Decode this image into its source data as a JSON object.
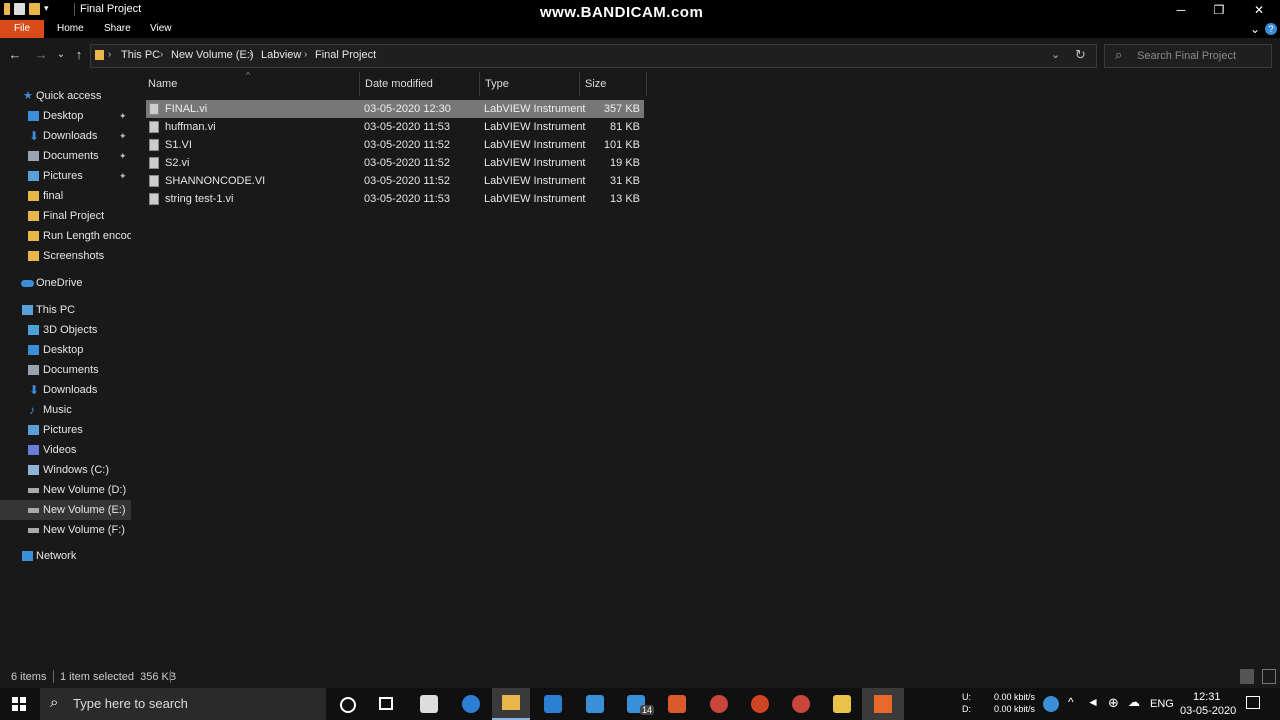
{
  "window": {
    "title": "Final Project",
    "watermark": "www.BANDICAM.com",
    "controls": {
      "minimize": "─",
      "maximize": "❐",
      "close": "✕"
    }
  },
  "ribbon": {
    "tabs": [
      "File",
      "Home",
      "Share",
      "View"
    ],
    "help": "?",
    "expand": "⌄"
  },
  "address": {
    "back": "←",
    "forward": "→",
    "recent": "⌄",
    "up": "↑",
    "crumbs": [
      "This PC",
      "New Volume (E:)",
      "Labview",
      "Final Project"
    ],
    "separator": "›",
    "dropdown": "⌄",
    "refresh": "↻"
  },
  "search": {
    "placeholder": "Search Final Project",
    "icon": "⌕"
  },
  "sidebar": {
    "quick_access": "Quick access",
    "quick_items": [
      "Desktop",
      "Downloads",
      "Documents",
      "Pictures",
      "final",
      "Final Project",
      "Run Length encodin",
      "Screenshots"
    ],
    "pin": "📌",
    "onedrive": "OneDrive",
    "this_pc": "This PC",
    "pc_items": [
      "3D Objects",
      "Desktop",
      "Documents",
      "Downloads",
      "Music",
      "Pictures",
      "Videos",
      "Windows (C:)",
      "New Volume (D:)",
      "New Volume (E:)",
      "New Volume (F:)"
    ],
    "network": "Network"
  },
  "columns": {
    "name": "Name",
    "date": "Date modified",
    "type": "Type",
    "size": "Size",
    "sort_arrow": "^"
  },
  "files": [
    {
      "name": "FINAL.vi",
      "date": "03-05-2020 12:30",
      "type": "LabVIEW Instrument",
      "size": "357 KB"
    },
    {
      "name": "huffman.vi",
      "date": "03-05-2020 11:53",
      "type": "LabVIEW Instrument",
      "size": "81 KB"
    },
    {
      "name": "S1.VI",
      "date": "03-05-2020 11:52",
      "type": "LabVIEW Instrument",
      "size": "101 KB"
    },
    {
      "name": "S2.vi",
      "date": "03-05-2020 11:52",
      "type": "LabVIEW Instrument",
      "size": "19 KB"
    },
    {
      "name": "SHANNONCODE.VI",
      "date": "03-05-2020 11:52",
      "type": "LabVIEW Instrument",
      "size": "31 KB"
    },
    {
      "name": "string test-1.vi",
      "date": "03-05-2020 11:53",
      "type": "LabVIEW Instrument",
      "size": "13 KB"
    }
  ],
  "status": {
    "items": "6 items",
    "selected": "1 item selected  356 KB"
  },
  "taskbar": {
    "search_placeholder": "Type here to search",
    "mail_badge": "14",
    "net_u_label": "U:",
    "net_d_label": "D:",
    "net_u": "0.00 kbit/s",
    "net_d": "0.00 kbit/s",
    "lang": "ENG",
    "time": "12:31",
    "date": "03-05-2020"
  },
  "colors": {
    "file_tab": "#d94c1a",
    "folder": "#e8b64a",
    "selection": "#777777",
    "accent_blue": "#3b8fd8"
  }
}
